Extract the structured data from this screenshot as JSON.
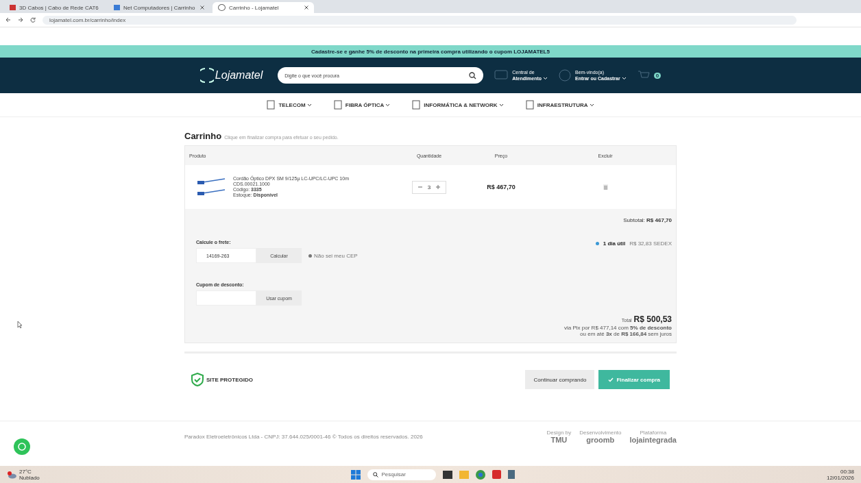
{
  "browser": {
    "tabs": [
      {
        "title": "3D Cabos | Cabo de Rede CAT6",
        "selected": false
      },
      {
        "title": "Net Computadores | Carrinho",
        "selected": false
      },
      {
        "title": "Carrinho - Lojamatel",
        "selected": true
      }
    ],
    "url": "lojamatel.com.br/carrinho/index"
  },
  "promo": "Cadastre-se e ganhe 5% de desconto na primeira compra utilizando o cupom LOJAMATEL5",
  "header": {
    "logo": "Lojamatel",
    "search_placeholder": "Digite o que você procura",
    "service": [
      "Central de",
      "Atendimento"
    ],
    "account": [
      "Bem-vindo(a)",
      "Entrar ou Cadastrar"
    ],
    "cart_count": "0"
  },
  "nav": [
    {
      "label": "TELECOM"
    },
    {
      "label": "FIBRA ÓPTICA"
    },
    {
      "label": "INFORMÁTICA & NETWORK"
    },
    {
      "label": "INFRAESTRUTURA"
    }
  ],
  "cart": {
    "title": "Carrinho",
    "subtitle": "Clique em finalizar compra para efetuar o seu pedido.",
    "columns": [
      "Produto",
      "Quantidade",
      "Preço",
      "Excluir"
    ],
    "items": [
      {
        "name": "Cordão Óptico DPX SM 9/125µ LC-UPC/LC-UPC 10m",
        "sku": "CDS.00021.1000",
        "code": "Código: **3335**",
        "stock": "Estoque: **Disponível**",
        "quantity": "3",
        "price": "R$ 467,70"
      }
    ],
    "subtotal": "Subtotal: **R$ 467,70**"
  },
  "shipping": {
    "label": "Calcule o frete:",
    "value": "14169-263",
    "button": "Calcular",
    "help": "Não sei meu CEP",
    "options": [
      {
        "label": "1 dia útil",
        "price": "R$ 32,83 SEDEX",
        "selected": true
      }
    ]
  },
  "coupon": {
    "label": "Cupom de desconto:",
    "button": "Usar cupom"
  },
  "total": {
    "label": "Total",
    "value": "R$ 500,53",
    "pix": "via Pix por R$ 477,14 com **5% de desconto**",
    "installments": "ou em até **3x** de **R$ 166,84** sem juros"
  },
  "seal": {
    "text": "SITE PROTEGIDO"
  },
  "actions": {
    "continue": "Continuar comprando",
    "finish": "Finalizar compra"
  },
  "footer": {
    "copyright": "Paradox Eletroeletrônicos Ltda - CNPJ: 37.644.025/0001-46 © Todos os direitos reservados. 2026",
    "credits": [
      {
        "caption": "Design by",
        "name": "TMU"
      },
      {
        "caption": "Desenvolvimento",
        "name": "groomb"
      },
      {
        "caption": "Plataforma",
        "name": "lojaintegrada"
      }
    ]
  },
  "taskbar": {
    "temperature": "27°C",
    "weather": "Nublado",
    "search_placeholder": "Pesquisar",
    "time": "00:38",
    "date": "12/01/2026"
  }
}
